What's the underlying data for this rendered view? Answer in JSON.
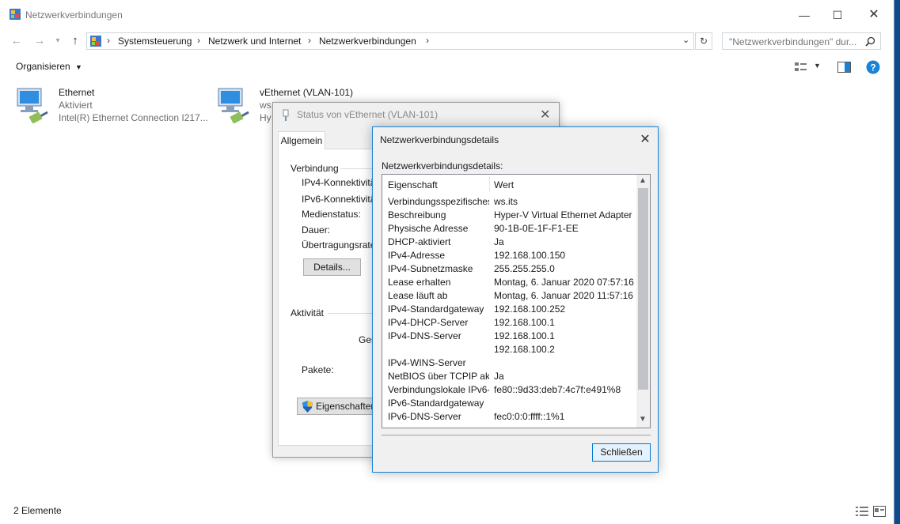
{
  "window": {
    "title": "Netzwerkverbindungen"
  },
  "address": {
    "segments": [
      "Systemsteuerung",
      "Netzwerk und Internet",
      "Netzwerkverbindungen"
    ],
    "search_placeholder": "\"Netzwerkverbindungen\" dur..."
  },
  "toolbar": {
    "organize_label": "Organisieren"
  },
  "connections": [
    {
      "name": "Ethernet",
      "status": "Aktiviert",
      "device": "Intel(R) Ethernet Connection I217..."
    },
    {
      "name": "vEthernet (VLAN-101)",
      "status": "ws.",
      "device": "Hy"
    }
  ],
  "statusbar": {
    "count": "2 Elemente"
  },
  "status_dialog": {
    "title": "Status von vEthernet (VLAN-101)",
    "tab": "Allgemein",
    "group_connection": "Verbindung",
    "labels": [
      "IPv4-Konnektivität",
      "IPv6-Konnektivität",
      "Medienstatus:",
      "Dauer:",
      "Übertragungsrate:"
    ],
    "details_button": "Details...",
    "group_activity": "Aktivität",
    "sent_partial": "Ges",
    "packets_label": "Pakete:",
    "properties_button": "Eigenschaften"
  },
  "details_dialog": {
    "title": "Netzwerkverbindungsdetails",
    "list_label": "Netzwerkverbindungsdetails:",
    "col_property": "Eigenschaft",
    "col_value": "Wert",
    "rows": [
      {
        "k": "Verbindungsspezifisches...",
        "v": "ws.its"
      },
      {
        "k": "Beschreibung",
        "v": "Hyper-V Virtual Ethernet Adapter"
      },
      {
        "k": "Physische Adresse",
        "v": "90-1B-0E-1F-F1-EE"
      },
      {
        "k": "DHCP-aktiviert",
        "v": "Ja"
      },
      {
        "k": "IPv4-Adresse",
        "v": "192.168.100.150"
      },
      {
        "k": "IPv4-Subnetzmaske",
        "v": "255.255.255.0"
      },
      {
        "k": "Lease erhalten",
        "v": "Montag, 6. Januar 2020 07:57:16"
      },
      {
        "k": "Lease läuft ab",
        "v": "Montag, 6. Januar 2020 11:57:16"
      },
      {
        "k": "IPv4-Standardgateway",
        "v": "192.168.100.252"
      },
      {
        "k": "IPv4-DHCP-Server",
        "v": "192.168.100.1"
      },
      {
        "k": "IPv4-DNS-Server",
        "v": "192.168.100.1"
      },
      {
        "k": "",
        "v": "192.168.100.2"
      },
      {
        "k": "IPv4-WINS-Server",
        "v": ""
      },
      {
        "k": "NetBIOS über TCPIP ak...",
        "v": "Ja"
      },
      {
        "k": "Verbindungslokale IPv6-...",
        "v": "fe80::9d33:deb7:4c7f:e491%8"
      },
      {
        "k": "IPv6-Standardgateway",
        "v": ""
      },
      {
        "k": "IPv6-DNS-Server",
        "v": "fec0:0:0:ffff::1%1"
      }
    ],
    "close_button": "Schließen"
  },
  "colors": {
    "accent": "#0078d7",
    "desktop": "#0f4a8a",
    "help": "#1883d7"
  }
}
